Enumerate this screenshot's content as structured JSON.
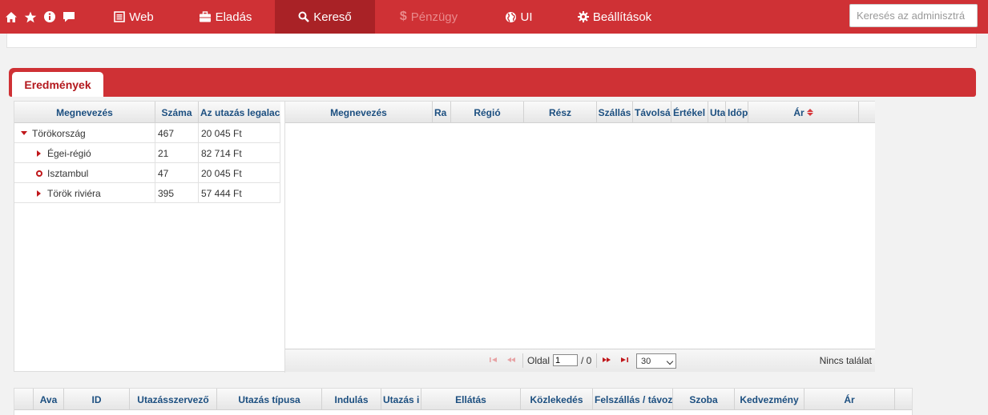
{
  "nav": {
    "items": [
      {
        "label": "Web",
        "icon": "list-icon"
      },
      {
        "label": "Eladás",
        "icon": "briefcase-icon"
      },
      {
        "label": "Kereső",
        "icon": "search-icon",
        "active": true
      },
      {
        "label": "Pénzügy",
        "icon": "dollar-icon",
        "disabled": true
      },
      {
        "label": "UI",
        "icon": "globe-icon"
      },
      {
        "label": "Beállítások",
        "icon": "gear-icon"
      }
    ],
    "search_placeholder": "Keresés az adminisztrá"
  },
  "tab": {
    "label": "Eredmények"
  },
  "tree_grid": {
    "headers": [
      "Megnevezés",
      "Száma",
      "Az utazás legalacs"
    ],
    "rows": [
      {
        "name": "Törökország",
        "count": "467",
        "price": "20 045 Ft"
      },
      {
        "name": "Égei-régió",
        "count": "21",
        "price": "82 714 Ft"
      },
      {
        "name": "Isztambul",
        "count": "47",
        "price": "20 045 Ft"
      },
      {
        "name": "Török riviéra",
        "count": "395",
        "price": "57 444 Ft"
      }
    ]
  },
  "result_grid": {
    "headers": [
      "Megnevezés",
      "Ra",
      "Régió",
      "Rész",
      "Szállás",
      "Távolsá",
      "Értékel",
      "Uta",
      "Időp",
      "Ár"
    ]
  },
  "pager": {
    "page_label": "Oldal",
    "page_value": "1",
    "page_total": "/ 0",
    "per_page": "30",
    "no_result": "Nincs találat"
  },
  "bottom_grid": {
    "headers": [
      "",
      "Ava",
      "ID",
      "Utazásszervező",
      "Utazás típusa",
      "Indulás",
      "Utazás i",
      "Ellátás",
      "Közlekedés",
      "Felszállás / távoz",
      "Szoba",
      "Kedvezmény",
      "Ár"
    ]
  },
  "colors": {
    "brand": "#cf3135",
    "active": "#a92226",
    "header_text": "#1c4f80"
  }
}
